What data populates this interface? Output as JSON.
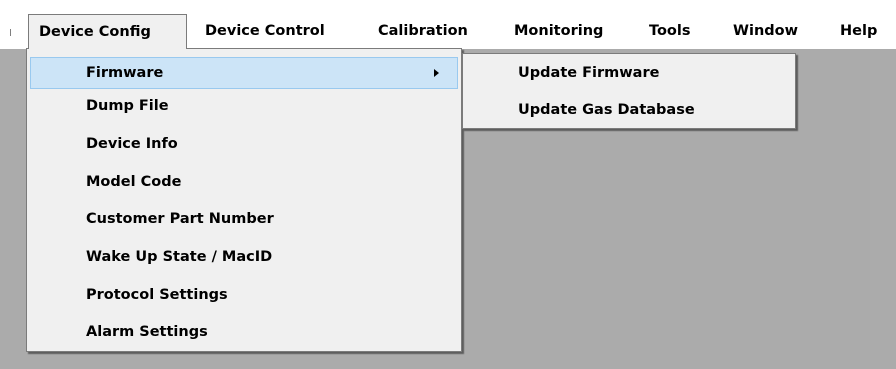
{
  "menubar": {
    "items": [
      {
        "label": "Device Config"
      },
      {
        "label": "Device Control"
      },
      {
        "label": "Calibration"
      },
      {
        "label": "Monitoring"
      },
      {
        "label": "Tools"
      },
      {
        "label": "Window"
      },
      {
        "label": "Help"
      }
    ]
  },
  "device_config_menu": {
    "items": [
      {
        "label": "Firmware"
      },
      {
        "label": "Dump File"
      },
      {
        "label": "Device Info"
      },
      {
        "label": "Model Code"
      },
      {
        "label": "Customer Part Number"
      },
      {
        "label": "Wake Up State / MacID"
      },
      {
        "label": "Protocol Settings"
      },
      {
        "label": "Alarm Settings"
      }
    ]
  },
  "firmware_submenu": {
    "items": [
      {
        "label": "Update Firmware"
      },
      {
        "label": "Update Gas Database"
      }
    ]
  },
  "colors": {
    "workspace": "#ababab",
    "menu_background": "#f0f0f0",
    "highlight": "#cce4f7",
    "highlight_border": "#99c9ef"
  }
}
